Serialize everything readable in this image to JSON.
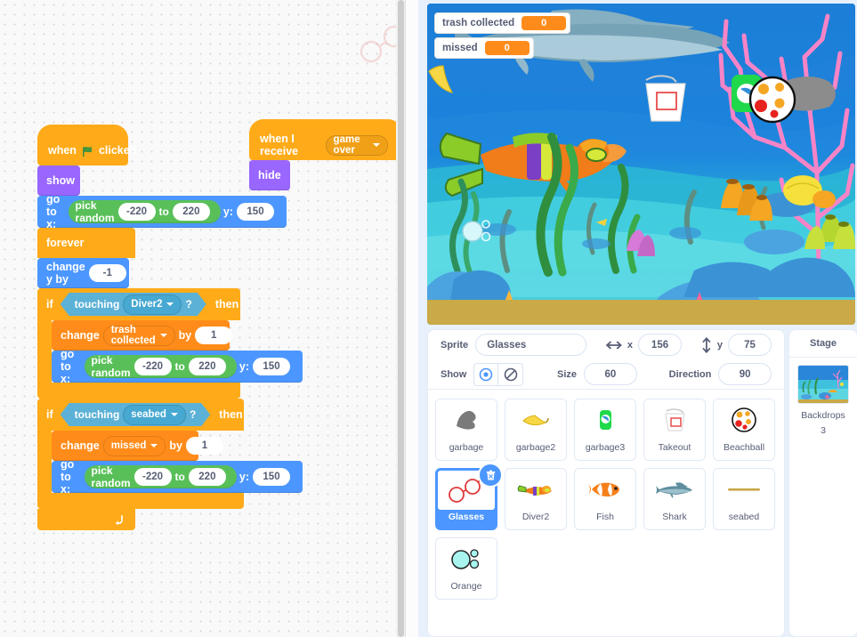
{
  "stage": {
    "monitors": [
      {
        "name": "trash collected",
        "value": "0"
      },
      {
        "name": "missed",
        "value": "0"
      }
    ]
  },
  "scripts": {
    "main": {
      "hat": {
        "when": "when",
        "clicked": "clicked",
        "icon": "green-flag-icon"
      },
      "show": "show",
      "goto": {
        "label": "go to x:",
        "pick_random": "pick random",
        "from": "-220",
        "to_label": "to",
        "to": "220",
        "y_label": "y:",
        "y": "150"
      },
      "forever": "forever",
      "change_y": {
        "label": "change y by",
        "value": "-1"
      },
      "if1": {
        "if": "if",
        "touching": "touching",
        "target": "Diver2",
        "q": "?",
        "then": "then"
      },
      "change_var1": {
        "change": "change",
        "var": "trash collected",
        "by": "by",
        "value": "1"
      },
      "goto2": {
        "label": "go to x:",
        "pick_random": "pick random",
        "from": "-220",
        "to_label": "to",
        "to": "220",
        "y_label": "y:",
        "y": "150"
      },
      "if2": {
        "if": "if",
        "touching": "touching",
        "target": "seabed",
        "q": "?",
        "then": "then"
      },
      "change_var2": {
        "change": "change",
        "var": "missed",
        "by": "by",
        "value": "1"
      },
      "goto3": {
        "label": "go to x:",
        "pick_random": "pick random",
        "from": "-220",
        "to_label": "to",
        "to": "220",
        "y_label": "y:",
        "y": "150"
      }
    },
    "secondary": {
      "hat": {
        "label": "when I receive",
        "message": "game over"
      },
      "hide": "hide"
    }
  },
  "sprite_info": {
    "sprite_label": "Sprite",
    "sprite_name": "Glasses",
    "x_label": "x",
    "x_value": "156",
    "y_label": "y",
    "y_value": "75",
    "show_label": "Show",
    "size_label": "Size",
    "size_value": "60",
    "direction_label": "Direction",
    "direction_value": "90",
    "show_icon": "eye-visible-icon",
    "hide_icon": "eye-hidden-icon",
    "x_icon": "horizontal-arrows-icon",
    "y_icon": "vertical-arrows-icon"
  },
  "sprites": [
    {
      "name": "garbage",
      "icon": "garbage-bag-icon",
      "selected": false
    },
    {
      "name": "garbage2",
      "icon": "banana-peel-icon",
      "selected": false
    },
    {
      "name": "garbage3",
      "icon": "soda-can-icon",
      "selected": false
    },
    {
      "name": "Takeout",
      "icon": "takeout-box-icon",
      "selected": false
    },
    {
      "name": "Beachball",
      "icon": "beachball-icon",
      "selected": false
    },
    {
      "name": "Glasses",
      "icon": "glasses-icon",
      "selected": true
    },
    {
      "name": "Diver2",
      "icon": "diver-icon",
      "selected": false
    },
    {
      "name": "Fish",
      "icon": "clownfish-icon",
      "selected": false
    },
    {
      "name": "Shark",
      "icon": "shark-icon",
      "selected": false
    },
    {
      "name": "seabed",
      "icon": "seabed-line-icon",
      "selected": false
    },
    {
      "name": "Orange",
      "icon": "bubbles-icon",
      "selected": false
    }
  ],
  "stage_panel": {
    "title": "Stage",
    "backdrops_label": "Backdrops",
    "backdrops_count": "3",
    "thumb_icon": "underwater-backdrop-icon"
  },
  "colors": {
    "events": "#ffbf00",
    "control": "#ffab19",
    "motion": "#4c97ff",
    "looks": "#9966ff",
    "operators": "#59c059",
    "sensing": "#5cb1d6",
    "variables": "#ff8c1a",
    "accent": "#4c97ff"
  }
}
